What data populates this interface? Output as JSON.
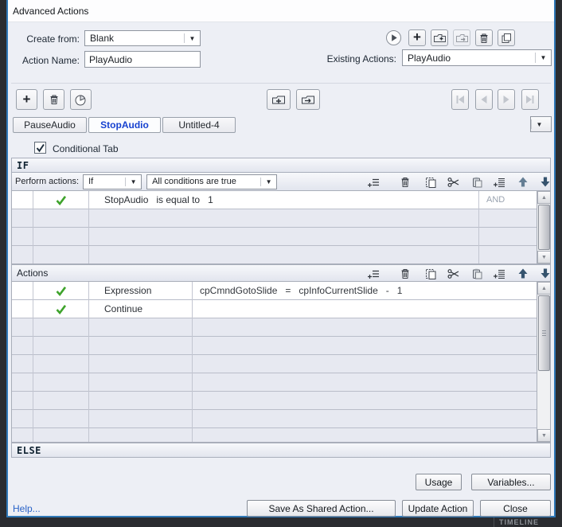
{
  "window": {
    "title": "Advanced Actions"
  },
  "background": {
    "timeline_label": "TIMELINE"
  },
  "header": {
    "create_from_label": "Create from:",
    "create_from_value": "Blank",
    "action_name_label": "Action Name:",
    "action_name_value": "PlayAudio",
    "existing_actions_label": "Existing Actions:",
    "existing_actions_value": "PlayAudio"
  },
  "tabs": {
    "items": [
      {
        "label": "PauseAudio"
      },
      {
        "label": "StopAudio"
      },
      {
        "label": "Untitled-4"
      }
    ]
  },
  "conditional_tab": {
    "label": "Conditional Tab",
    "checked": true
  },
  "if_section": {
    "header": "IF",
    "perform_label": "Perform actions:",
    "mode_value": "If",
    "condition_mode_value": "All conditions are true",
    "rows": [
      {
        "condition": "StopAudio   is equal to   1",
        "operator": "AND"
      }
    ],
    "empty_row_count": 3
  },
  "actions_section": {
    "header": "Actions",
    "rows": [
      {
        "action": "Expression",
        "value": "cpCmndGotoSlide   =   cpInfoCurrentSlide   -   1"
      },
      {
        "action": "Continue",
        "value": ""
      }
    ],
    "empty_row_count": 7
  },
  "else_section": {
    "header": "ELSE"
  },
  "footer": {
    "usage": "Usage",
    "variables": "Variables...",
    "help": "Help...",
    "save_shared": "Save As Shared Action...",
    "update": "Update Action",
    "close": "Close"
  },
  "icons": {
    "dropdown_arrow": "▼",
    "scroll_up": "▲",
    "scroll_down": "▼",
    "toolbar_top": [
      "preview-icon",
      "add-action-icon",
      "import-action-icon",
      "export-action-icon",
      "delete-action-icon",
      "duplicate-action-icon"
    ],
    "tab_toolbar": [
      "add-tab-icon",
      "delete-tab-icon",
      "duplicate-tab-icon",
      "group-in-icon",
      "group-out-icon",
      "nav-first-icon",
      "nav-prev-icon",
      "nav-next-icon",
      "nav-last-icon"
    ],
    "row_toolbar": [
      "add-row-icon",
      "delete-row-icon",
      "copy-row-icon",
      "cut-row-icon",
      "paste-row-icon",
      "insert-row-icon",
      "move-up-icon",
      "move-down-icon"
    ],
    "status": [
      "green-check-icon"
    ]
  },
  "colors": {
    "dialog_border": "#2f78b7",
    "active_tab_text": "#1742d0",
    "check_green": "#3ea32b",
    "row_stripe": "#e7e9f1"
  }
}
